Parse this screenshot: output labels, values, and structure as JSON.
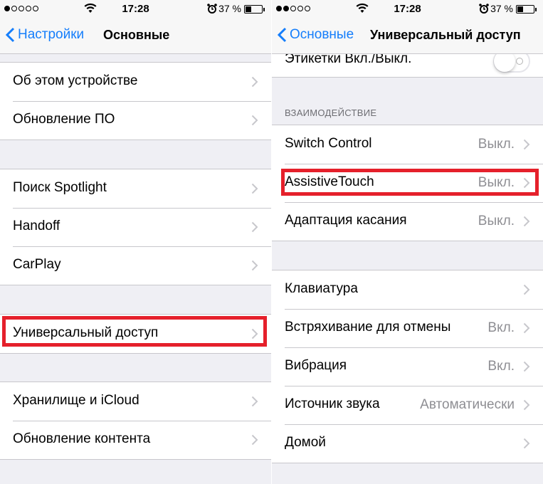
{
  "status": {
    "time": "17:28",
    "battery": "37 %"
  },
  "left": {
    "back_label": "Настройки",
    "title": "Основные",
    "groups": [
      [
        "Об этом устройстве",
        "Обновление ПО"
      ],
      [
        "Поиск Spotlight",
        "Handoff",
        "CarPlay"
      ],
      [
        "Универсальный доступ"
      ],
      [
        "Хранилище и iCloud",
        "Обновление контента"
      ]
    ]
  },
  "right": {
    "back_label": "Основные",
    "title": "Универсальный доступ",
    "top_row": {
      "label": "Этикетки Вкл./Выкл.",
      "toggle": "off"
    },
    "interaction_header": "ВЗАИМОДЕЙСТВИЕ",
    "interaction": [
      {
        "label": "Switch Control",
        "value": "Выкл."
      },
      {
        "label": "AssistiveTouch",
        "value": "Выкл."
      },
      {
        "label": "Адаптация касания",
        "value": "Выкл."
      }
    ],
    "more": [
      {
        "label": "Клавиатура",
        "value": ""
      },
      {
        "label": "Встряхивание для отмены",
        "value": "Вкл."
      },
      {
        "label": "Вибрация",
        "value": "Вкл."
      },
      {
        "label": "Источник звука",
        "value": "Автоматически"
      },
      {
        "label": "Домой",
        "value": ""
      }
    ]
  },
  "colors": {
    "accent": "#157efb",
    "highlight": "#e5202b",
    "background": "#efeff4",
    "secondary_text": "#8e8e93"
  }
}
